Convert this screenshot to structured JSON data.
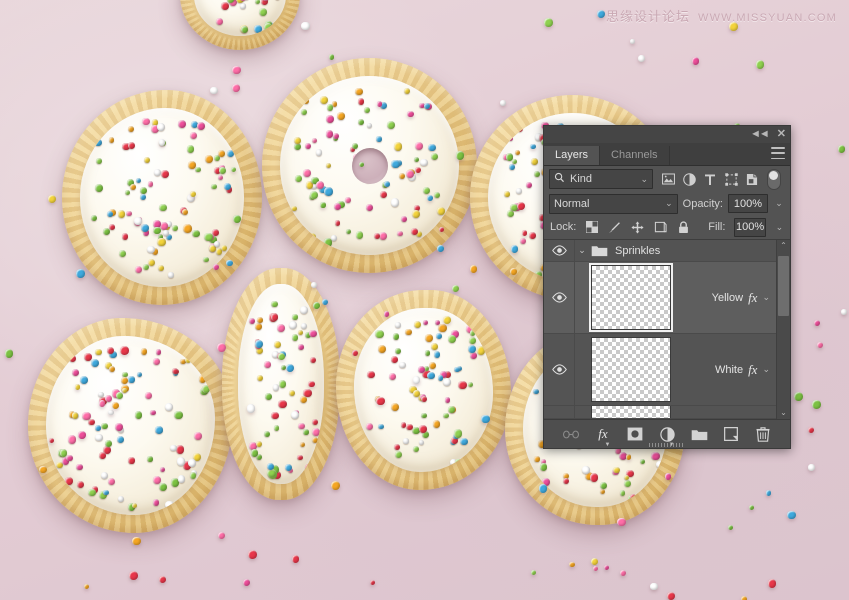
{
  "watermark": {
    "cn_text": "思缘设计论坛",
    "url_text": "WWW.MISSYUAN.COM"
  },
  "canvas": {
    "description": "Photo of cookie letters spelling COOKIES with white icing and rainbow sprinkles on a pink background",
    "background_color": "#e3ccd4",
    "biscuit_color": "#eccf8f",
    "icing_color": "#fdfaf0",
    "sprinkle_colors": [
      "#e8374a",
      "#f5a623",
      "#f3d33b",
      "#7cc242",
      "#3fa9dd",
      "#ee4f9b",
      "#ffffff",
      "#8fd14f",
      "#ff6ea8"
    ]
  },
  "panel": {
    "titlebar": {
      "collapse_label": "◄◄",
      "close_label": "✕"
    },
    "tabs": [
      {
        "label": "Layers",
        "active": true
      },
      {
        "label": "Channels",
        "active": false
      }
    ],
    "menu_icon": "hamburger-menu-icon",
    "filter": {
      "search_icon": "search-icon",
      "kind_label": "Kind",
      "chevron": "⌄",
      "icons": [
        "pixel-layer-filter-icon",
        "adjustment-layer-filter-icon",
        "type-layer-filter-icon",
        "shape-layer-filter-icon",
        "smart-object-filter-icon"
      ],
      "toggle_name": "filter-enable-toggle"
    },
    "blend": {
      "mode_label": "Normal",
      "mode_chevron": "⌄",
      "opacity_label": "Opacity:",
      "opacity_value": "100%",
      "opacity_chevron": "⌄"
    },
    "lock": {
      "label": "Lock:",
      "icons": [
        "lock-transparent-pixels-icon",
        "lock-image-pixels-icon",
        "lock-position-icon",
        "lock-artboard-nesting-icon",
        "lock-all-icon"
      ],
      "fill_label": "Fill:",
      "fill_value": "100%",
      "fill_chevron": "⌄"
    },
    "layers": [
      {
        "type": "group",
        "name": "Sprinkles",
        "visible": true,
        "expanded": true,
        "chevron": "⌄"
      },
      {
        "type": "layer",
        "name": "Yellow",
        "visible": true,
        "selected": true,
        "has_fx": true,
        "fx_label": "fx",
        "fx_chevron": "⌄"
      },
      {
        "type": "layer",
        "name": "White",
        "visible": true,
        "selected": false,
        "has_fx": true,
        "fx_label": "fx",
        "fx_chevron": "⌄"
      }
    ],
    "scrollbar": {
      "up_arrow": "⌃",
      "down_arrow": "⌄"
    },
    "footer_buttons": [
      "link-layers-button",
      "add-layer-style-button",
      "add-layer-mask-button",
      "new-adjustment-layer-button",
      "new-group-button",
      "new-layer-button",
      "delete-layer-button"
    ],
    "footer_fx_label": "fx"
  }
}
